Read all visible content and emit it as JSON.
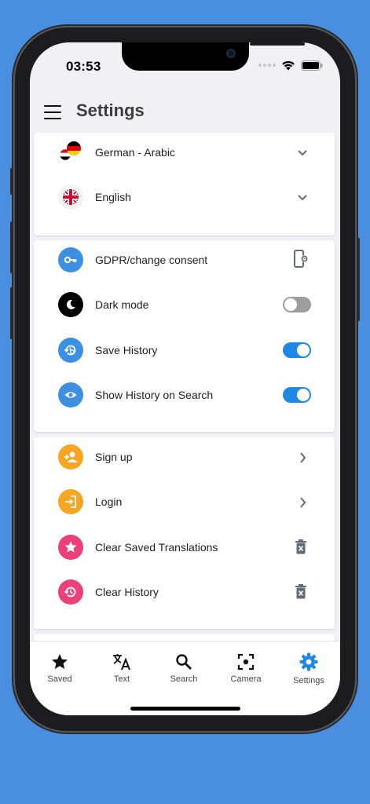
{
  "status": {
    "time": "03:53"
  },
  "header": {
    "title": "Settings"
  },
  "languages": {
    "items": [
      {
        "label": "German - Arabic",
        "icon": "germany-egypt-flags-icon"
      },
      {
        "label": "English",
        "icon": "uk-flag-icon"
      }
    ]
  },
  "preferences": {
    "items": [
      {
        "label": "GDPR/change consent",
        "icon": "key-icon",
        "right": "phone-settings-icon"
      },
      {
        "label": "Dark mode",
        "icon": "moon-icon",
        "toggle": false
      },
      {
        "label": "Save History",
        "icon": "history-settings-icon",
        "toggle": true
      },
      {
        "label": "Show History on Search",
        "icon": "eye-icon",
        "toggle": true
      }
    ]
  },
  "account": {
    "items": [
      {
        "label": "Sign up",
        "icon": "add-person-icon"
      },
      {
        "label": "Login",
        "icon": "login-icon"
      },
      {
        "label": "Clear Saved Translations",
        "icon": "star-icon"
      },
      {
        "label": "Clear History",
        "icon": "history-icon"
      }
    ]
  },
  "tabs": [
    {
      "label": "Saved",
      "icon": "star-icon"
    },
    {
      "label": "Text",
      "icon": "translate-icon"
    },
    {
      "label": "Search",
      "icon": "search-icon"
    },
    {
      "label": "Camera",
      "icon": "camera-scan-icon"
    },
    {
      "label": "Settings",
      "icon": "gear-icon",
      "active": true
    }
  ],
  "colors": {
    "background": "#4a8ee0",
    "blue_accent": "#3d8fe0",
    "orange": "#f6a623",
    "pink": "#ec407a",
    "toggle_on": "#1e88e5",
    "toggle_off": "#9e9e9e"
  }
}
